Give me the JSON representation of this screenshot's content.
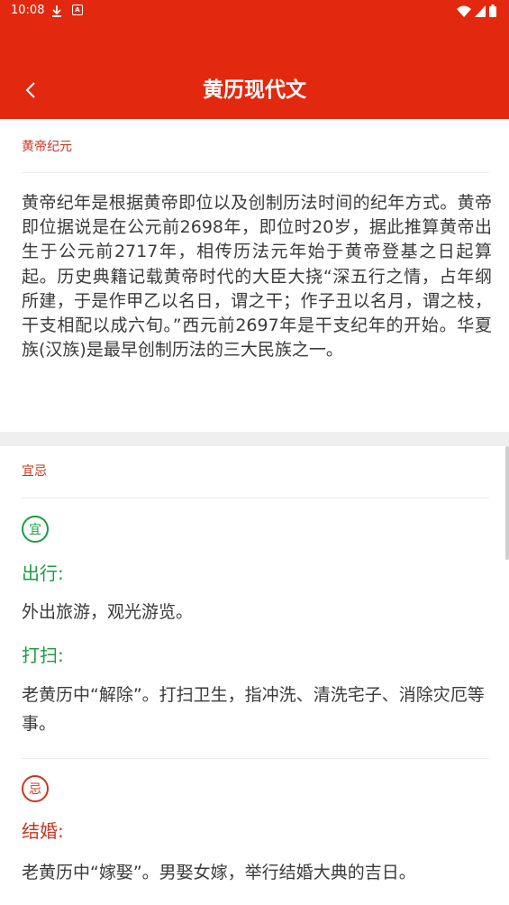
{
  "colors": {
    "primary": "#e2280e",
    "good": "#1a9e3f",
    "bad": "#d0341e",
    "text": "#3b3b3b",
    "section_gap": "#efefef"
  },
  "status_bar": {
    "time": "10:08",
    "icons": [
      "download-icon",
      "a-badge-icon",
      "wifi-icon",
      "signal-icon",
      "battery-icon"
    ]
  },
  "app_bar": {
    "back_icon": "chevron-left-icon",
    "title": "黄历现代文"
  },
  "section_era": {
    "title": "黄帝纪元",
    "body": "黄帝纪年是根据黄帝即位以及创制历法时间的纪年方式。黄帝即位据说是在公元前2698年，即位时20岁，据此推算黄帝出生于公元前2717年，相传历法元年始于黄帝登基之日起算起。历史典籍记载黄帝时代的大臣大挠“深五行之情，占年纲所建，于是作甲乙以名日，谓之干；作子丑以名月，谓之枝，干支相配以成六旬。”西元前2697年是干支纪年的开始。华夏族(汉族)是最早创制历法的三大民族之一。"
  },
  "section_yiji": {
    "title": "宜忌",
    "yi_badge": "宜",
    "ji_badge": "忌",
    "good_items": [
      {
        "name": "出行:",
        "desc": "外出旅游，观光游览。"
      },
      {
        "name": "打扫:",
        "desc": "老黄历中“解除”。打扫卫生，指冲洗、清洗宅子、消除灾厄等事。"
      }
    ],
    "bad_items": [
      {
        "name": "结婚:",
        "desc": "老黄历中“嫁娶”。男娶女嫁，举行结婚大典的吉日。"
      }
    ]
  }
}
